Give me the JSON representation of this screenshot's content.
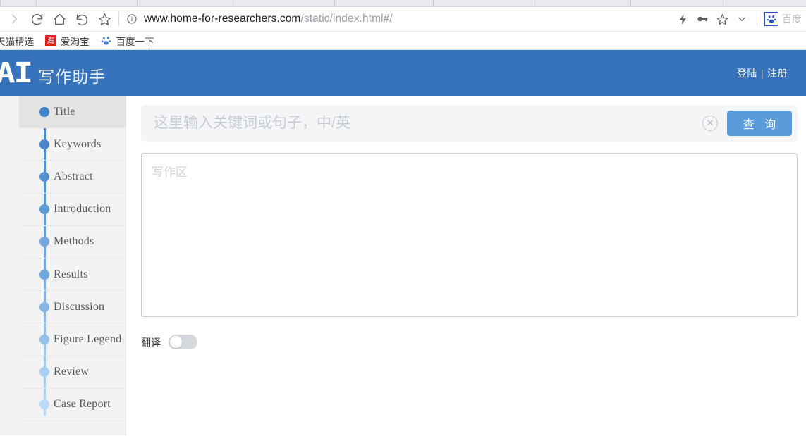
{
  "browser": {
    "tabs_widths": [
      52,
      143,
      140,
      140,
      140,
      140,
      140,
      135,
      133,
      140,
      140,
      140
    ],
    "nav": {
      "forward_icon": "forward-arrow-icon",
      "reload_icon": "reload-icon",
      "home_icon": "home-icon",
      "back_icon": "back-arrow-icon",
      "bookmark_star_icon": "star-icon"
    },
    "address": {
      "info_icon": "info-circle-icon",
      "domain": "www.home-for-researchers.com",
      "path": "/static/index.html#/"
    },
    "toolbar_right": {
      "lightning_icon": "lightning-bolt-icon",
      "key_icon": "key-icon",
      "star_icon": "star-icon",
      "chevron_icon": "chevron-down-icon",
      "extension_icon": "baidu-paw-icon",
      "extension_label": "百度"
    },
    "bookmarks": [
      {
        "label": "天猫精选",
        "icon": "tmall-icon"
      },
      {
        "label": "爱淘宝",
        "icon": "taobao-icon",
        "icon_char": "淘"
      },
      {
        "label": "百度一下",
        "icon": "baidu-paw-icon"
      }
    ]
  },
  "app": {
    "header": {
      "logo_mark": "AI",
      "logo_text": "写作助手",
      "login_label": "登陆",
      "divider": "|",
      "register_label": "注册",
      "bg_color": "#3673bc"
    },
    "sidebar": {
      "items": [
        {
          "label": "Title",
          "dot_color": "#4083c8",
          "active": true
        },
        {
          "label": "Keywords",
          "dot_color": "#4786cb",
          "active": false
        },
        {
          "label": "Abstract",
          "dot_color": "#5190d0",
          "active": false
        },
        {
          "label": "Introduction",
          "dot_color": "#5d9ad6",
          "active": false
        },
        {
          "label": "Methods",
          "dot_color": "#72a8dd",
          "active": false
        },
        {
          "label": "Results",
          "dot_color": "#6fa6dc",
          "active": false
        },
        {
          "label": "Discussion",
          "dot_color": "#86b6e4",
          "active": false
        },
        {
          "label": "Figure Legend",
          "dot_color": "#93bfe9",
          "active": false
        },
        {
          "label": "Review",
          "dot_color": "#abcef2",
          "active": false
        },
        {
          "label": "Case Report",
          "dot_color": "#bcd9f6",
          "active": false
        }
      ]
    },
    "search": {
      "placeholder": "这里输入关键词或句子，中/英",
      "value": "",
      "clear_icon": "close-circle-icon",
      "button_label": "查 询",
      "button_color": "#5b9bd9"
    },
    "editor": {
      "placeholder": "写作区",
      "value": ""
    },
    "translate": {
      "label": "翻译",
      "enabled": false
    }
  }
}
